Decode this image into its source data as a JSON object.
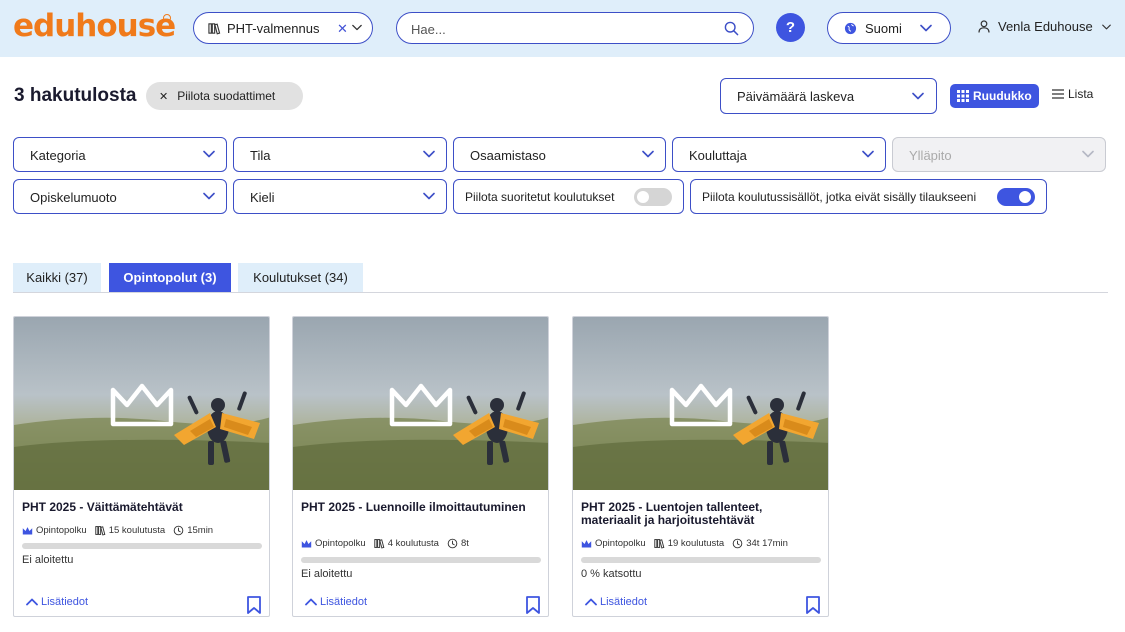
{
  "header": {
    "logo": "eduhouse",
    "org_select": {
      "label": "PHT-valmennus"
    },
    "search": {
      "placeholder": "Hae..."
    },
    "help_label": "?",
    "language": "Suomi",
    "user": "Venla Eduhouse"
  },
  "results": {
    "count_label": "3 hakutulosta",
    "hide_filters_label": "Piilota suodattimet",
    "sort_label": "Päivämäärä laskeva",
    "view_grid_label": "Ruudukko",
    "view_list_label": "Lista"
  },
  "filters": {
    "category": "Kategoria",
    "status": "Tila",
    "skill_level": "Osaamistaso",
    "trainer": "Kouluttaja",
    "maintenance": "Ylläpito",
    "study_mode": "Opiskelumuoto",
    "language": "Kieli",
    "hide_completed": {
      "label": "Piilota suoritetut koulutukset",
      "on": false
    },
    "hide_not_in_subscription": {
      "label": "Piilota koulutussisällöt, jotka eivät sisälly tilaukseeni",
      "on": true
    }
  },
  "tabs": [
    {
      "label": "Kaikki (37)",
      "active": false
    },
    {
      "label": "Opintopolut (3)",
      "active": true
    },
    {
      "label": "Koulutukset (34)",
      "active": false
    }
  ],
  "cards": [
    {
      "title": "PHT 2025 - Väittämätehtävät",
      "type": "Opintopolku",
      "trainings": "15 koulutusta",
      "duration": "15min",
      "progress": 0,
      "status": "Ei aloitettu",
      "more": "Lisätiedot"
    },
    {
      "title": "PHT 2025 - Luennoille ilmoittautuminen",
      "type": "Opintopolku",
      "trainings": "4 koulutusta",
      "duration": "8t",
      "progress": 0,
      "status": "Ei aloitettu",
      "more": "Lisätiedot"
    },
    {
      "title": "PHT 2025 - Luentojen tallenteet, materiaalit ja harjoitustehtävät",
      "type": "Opintopolku",
      "trainings": "19 koulutusta",
      "duration": "34t 17min",
      "progress": 0,
      "status": "0 % katsottu",
      "more": "Lisätiedot"
    }
  ],
  "colors": {
    "accent": "#3e55e0",
    "brand": "#f07a1a",
    "header_bg": "#dfeefa"
  }
}
